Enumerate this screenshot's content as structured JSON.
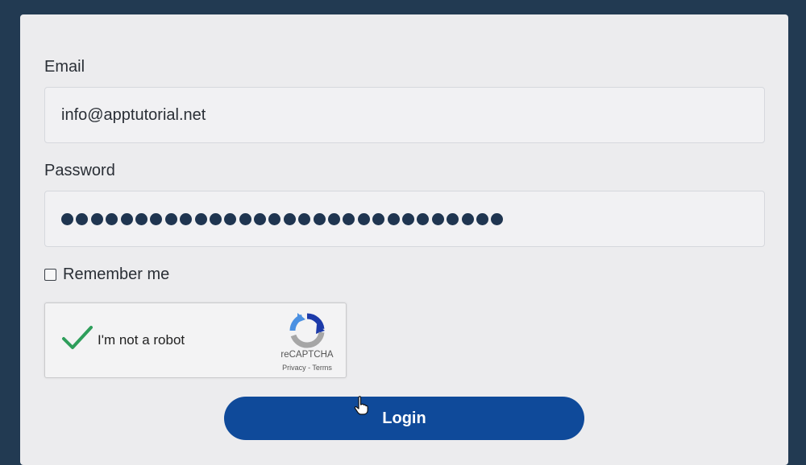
{
  "form": {
    "email_label": "Email",
    "email_value": "info@apptutorial.net",
    "password_label": "Password",
    "password_mask_count": 30,
    "remember_label": "Remember me",
    "remember_checked": false
  },
  "recaptcha": {
    "label": "I'm not a robot",
    "brand": "reCAPTCHA",
    "links": "Privacy - Terms",
    "checked": true,
    "check_color": "#2e9e5b",
    "icon": "recaptcha-logo-icon"
  },
  "login_button": {
    "label": "Login",
    "color": "#0f4a9a"
  },
  "colors": {
    "page_background": "#223a52",
    "card_background": "#ececee",
    "password_dot": "#1f3550"
  }
}
